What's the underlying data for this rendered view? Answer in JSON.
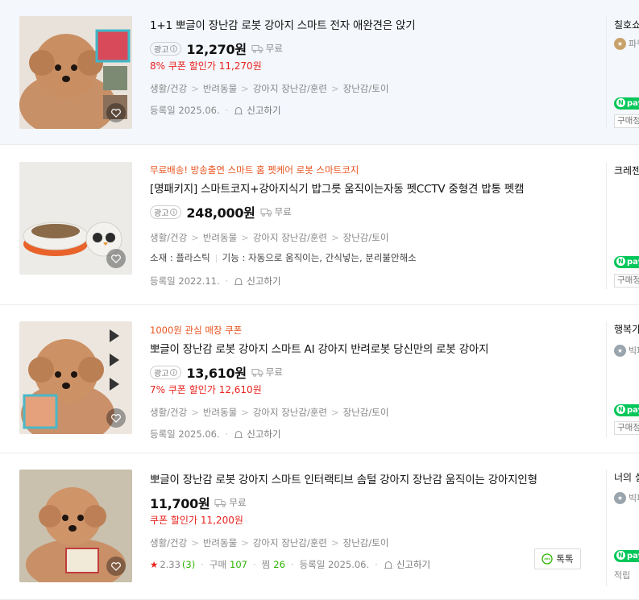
{
  "colors": {
    "accent_red": "#e8231e",
    "promo_orange": "#e8541e",
    "npay_green": "#03c75a",
    "review_green": "#2db400"
  },
  "items": [
    {
      "title": "1+1 뽀글이 장난감 로봇 강아지 스마트 전자 애완견은 앉기",
      "ad_label": "광고",
      "price": "12,270원",
      "shipping": "무료",
      "coupon_prefix": "8% 쿠폰 할인가",
      "coupon_price": "11,270원",
      "category": [
        "생활/건강",
        "반려동물",
        "강아지 장난감/훈련",
        "장난감/토이"
      ],
      "reg_date": "등록일 2025.06.",
      "report": "신고하기",
      "seller": "칠호쇼",
      "seller_grade": "파워",
      "npay": "pay",
      "seller_tag": "구매정"
    },
    {
      "promo": "무료배송! 방송출연 스마트 홈 펫케어 로봇 스마트코지",
      "title": "[명패키지] 스마트코지+강아지식기 밥그릇 움직이는자동 펫CCTV 중형견 밥통 펫캠",
      "ad_label": "광고",
      "price": "248,000원",
      "shipping": "무료",
      "category": [
        "생활/건강",
        "반려동물",
        "강아지 장난감/훈련",
        "장난감/토이"
      ],
      "attr1": "소재 : 플라스틱",
      "attr2": "기능 : 자동으로 움직이는, 간식넣는, 분리불안해소",
      "reg_date": "등록일 2022.11.",
      "report": "신고하기",
      "seller": "크레젠",
      "npay": "pay",
      "seller_tag": "구매정"
    },
    {
      "promo": "1000원 관심 매장 쿠폰",
      "title": "뽀글이 장난감 로봇 강아지 스마트 AI 강아지 반려로봇 당신만의 로봇 강아지",
      "ad_label": "광고",
      "price": "13,610원",
      "shipping": "무료",
      "coupon_prefix": "7% 쿠폰 할인가",
      "coupon_price": "12,610원",
      "category": [
        "생활/건강",
        "반려동물",
        "강아지 장난감/훈련",
        "장난감/토이"
      ],
      "reg_date": "등록일 2025.06.",
      "report": "신고하기",
      "seller": "행복가",
      "seller_grade": "빅파",
      "npay": "pay",
      "seller_tag": "구매정"
    },
    {
      "title": "뽀글이 장난감 로봇 강아지 스마트 인터랙티브 솜털 강아지 장난감 움직이는 강아지인형",
      "price": "11,700원",
      "shipping": "무료",
      "coupon_prefix": "쿠폰 할인가",
      "coupon_price": "11,200원",
      "category": [
        "생활/건강",
        "반려동물",
        "강아지 장난감/훈련",
        "장난감/토이"
      ],
      "rating": "2.33",
      "rating_count": "(3)",
      "purchase_label": "구매",
      "purchase_count": "107",
      "zzim_label": "찜",
      "zzim_count": "26",
      "reg_date": "등록일 2025.06.",
      "report": "신고하기",
      "talk": "톡톡",
      "seller": "너의 실",
      "seller_grade": "빅파",
      "npay": "pay",
      "seller_tag": "적립"
    }
  ]
}
